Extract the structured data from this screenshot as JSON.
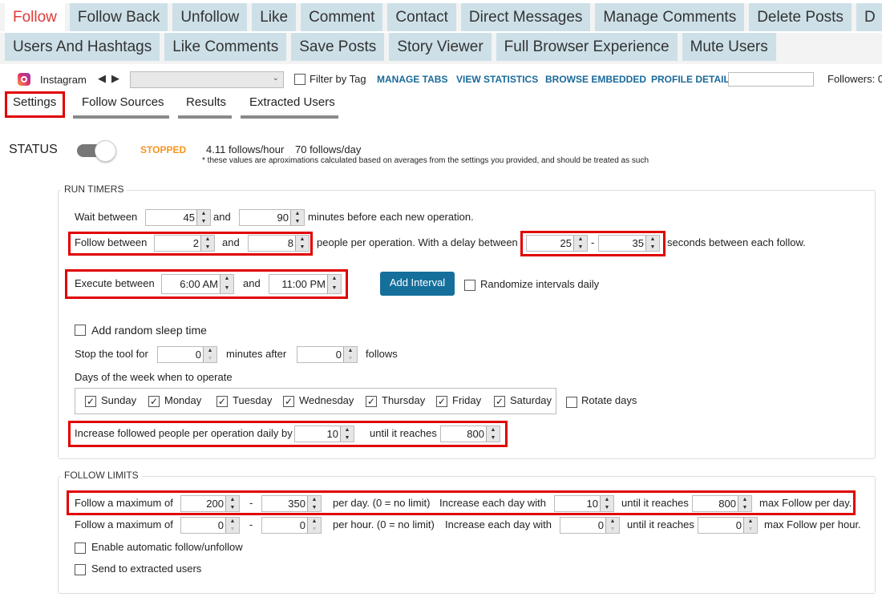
{
  "tabs_row1": [
    "Follow",
    "Follow Back",
    "Unfollow",
    "Like",
    "Comment",
    "Contact",
    "Direct Messages",
    "Manage Comments",
    "Delete Posts",
    "D"
  ],
  "tabs_row2": [
    "Users And Hashtags",
    "Like Comments",
    "Save Posts",
    "Story Viewer",
    "Full Browser Experience",
    "Mute Users"
  ],
  "toolbar": {
    "account": "Instagram",
    "filter_by_tag": "Filter by Tag",
    "links": [
      "MANAGE TABS",
      "VIEW STATISTICS",
      "BROWSE EMBEDDED",
      "PROFILE DETAILS"
    ],
    "followers": "Followers: 0"
  },
  "subtabs": [
    "Settings",
    "Follow Sources",
    "Results",
    "Extracted Users"
  ],
  "status": {
    "label": "STATUS",
    "state": "STOPPED",
    "state_color": "#f7941d",
    "per_hour": "4.11  follows/hour",
    "per_day": "70  follows/day",
    "note": "* these values are aproximations calculated based on averages from the settings you provided, and should be treated as such"
  },
  "run_timers": {
    "title": "RUN TIMERS",
    "wait": {
      "label": "Wait between",
      "min": "45",
      "and": "and",
      "max": "90",
      "suffix": "minutes before each new operation."
    },
    "follow": {
      "label": "Follow between",
      "min": "2",
      "and": "and",
      "max": "8",
      "suffix": "people per operation.  With a delay between",
      "delay_min": "25",
      "dash": "-",
      "delay_max": "35",
      "delay_suffix": "seconds between each follow."
    },
    "execute": {
      "label": "Execute between",
      "start": "6:00 AM",
      "and": "and",
      "end": "11:00 PM"
    },
    "add_interval": "Add Interval",
    "randomize": "Randomize intervals daily",
    "random_sleep": "Add random sleep time",
    "stop": {
      "label": "Stop the tool for",
      "minutes": "0",
      "mid": "minutes after",
      "follows": "0",
      "suffix": "follows"
    },
    "days_label": "Days of the week when to operate",
    "days": [
      "Sunday",
      "Monday",
      "Tuesday",
      "Wednesday",
      "Thursday",
      "Friday",
      "Saturday"
    ],
    "rotate_days": "Rotate days",
    "increase": {
      "label": "Increase followed people per operation daily by",
      "value": "10",
      "mid": "until it reaches",
      "max": "800"
    }
  },
  "follow_limits": {
    "title": "FOLLOW LIMITS",
    "day": {
      "label": "Follow a maximum of",
      "min": "200",
      "dash": "-",
      "max": "350",
      "note": "per day. (0 = no limit)",
      "inc_label": "Increase each day with",
      "inc": "10",
      "until": "until it reaches",
      "reach": "800",
      "suffix": "max Follow per day."
    },
    "hour": {
      "label": "Follow a maximum of",
      "min": "0",
      "dash": "-",
      "max": "0",
      "note": "per hour. (0 = no limit)",
      "inc_label": "Increase each day with",
      "inc": "0",
      "until": "until it reaches",
      "reach": "0",
      "suffix": "max Follow per hour."
    },
    "auto": "Enable automatic follow/unfollow",
    "send": "Send to extracted users"
  }
}
